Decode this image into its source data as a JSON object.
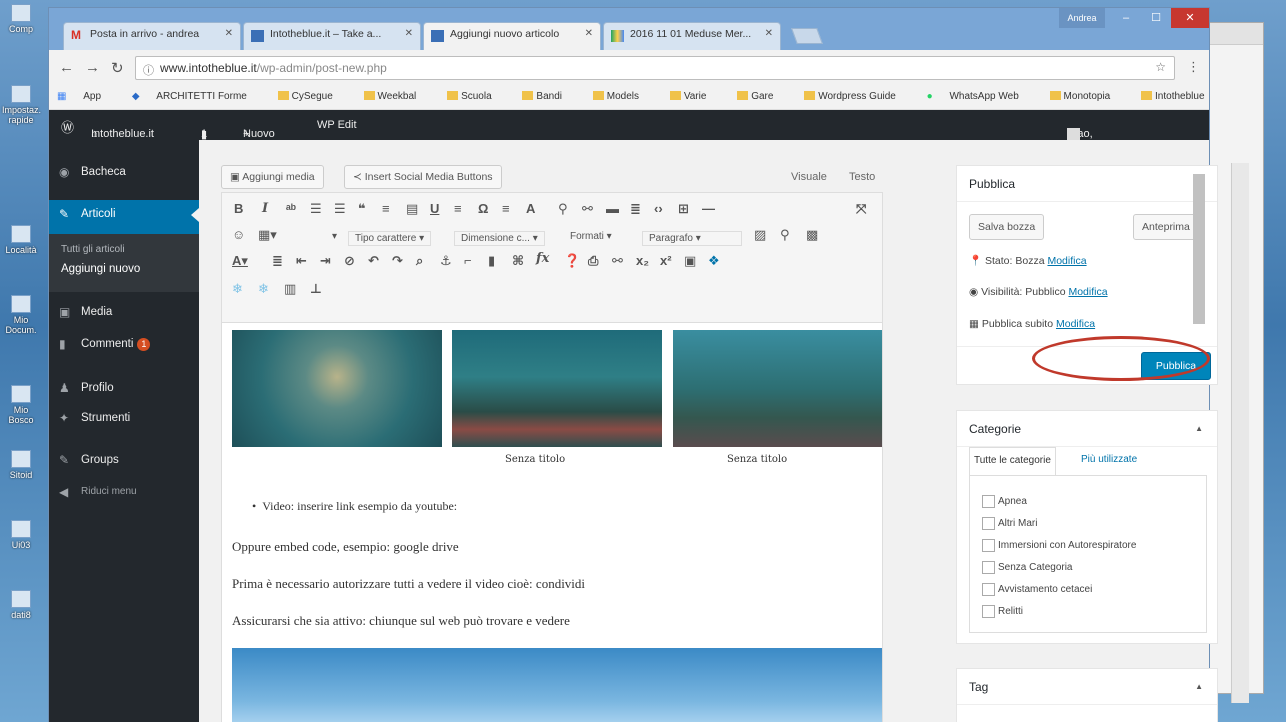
{
  "desktop": {
    "icons": [
      "Comp",
      "Impostaz. rapide",
      "Località",
      "Mio Docum.",
      "Mio Bosco",
      "Sitoid",
      "Ui03",
      "dati8"
    ]
  },
  "browser": {
    "tabs": [
      {
        "label": "Posta in arrivo - andrea",
        "icon": "gmail-icon"
      },
      {
        "label": "Intotheblue.it – Take a...",
        "icon": "blogger-icon"
      },
      {
        "label": "Aggiungi nuovo articolo",
        "icon": "blogger-icon"
      },
      {
        "label": "2016 11 01 Meduse Mer...",
        "icon": "drive-icon"
      }
    ],
    "window_user": "Andrea",
    "url_host": "www.intotheblue.it",
    "url_path": "/wp-admin/post-new.php",
    "bookmarks": [
      "App",
      "ARCHITETTI Forme",
      "CySegue",
      "Weekbal",
      "Scuola",
      "Bandi",
      "Models",
      "Varie",
      "Gare",
      "Wordpress Guide",
      "WhatsApp Web",
      "Monotopia",
      "Intotheblue"
    ]
  },
  "adminbar": {
    "site": "Intotheblue.it",
    "comments": "1",
    "new": "Nuovo",
    "wp_edit": "WP Edit",
    "greeting": "Ciao, netartstudio"
  },
  "sidebar": {
    "dashboard": "Bacheca",
    "posts": "Articoli",
    "all_posts": "Tutti gli articoli",
    "add_new": "Aggiungi nuovo",
    "media": "Media",
    "comments": "Commenti",
    "comments_count": "1",
    "profile": "Profilo",
    "tools": "Strumenti",
    "groups": "Groups",
    "collapse": "Riduci menu"
  },
  "editor": {
    "add_media": "Aggiungi media",
    "social": "Insert Social Media Buttons",
    "tab_visual": "Visuale",
    "tab_text": "Testo",
    "font_family": "Tipo carattere",
    "font_size": "Dimensione c...",
    "formats": "Formati",
    "paragraph": "Paragrafo",
    "captions": [
      "Senza titolo",
      "Senza titolo"
    ],
    "bullet": "Video: inserire link esempio da youtube:",
    "p1": "Oppure embed code, esempio: google drive",
    "p2": "Prima è necessario autorizzare tutti a vedere il video cioè: condividi",
    "p3": "Assicurarsi che sia attivo: chiunque sul web può trovare e vedere"
  },
  "publish": {
    "title": "Pubblica",
    "save_draft": "Salva bozza",
    "preview": "Anteprima",
    "status_label": "Stato: Bozza",
    "visibility_label": "Visibilità: Pubblico",
    "schedule_label": "Pubblica subito",
    "edit_link": "Modifica",
    "publish_button": "Pubblica"
  },
  "categories": {
    "title": "Categorie",
    "tab_all": "Tutte le categorie",
    "tab_used": "Più utilizzate",
    "items": [
      "Apnea",
      "Altri Mari",
      "Immersioni con Autorespiratore",
      "Senza Categoria",
      "Avvistamento cetacei",
      "Relitti"
    ]
  },
  "tags": {
    "title": "Tag"
  }
}
